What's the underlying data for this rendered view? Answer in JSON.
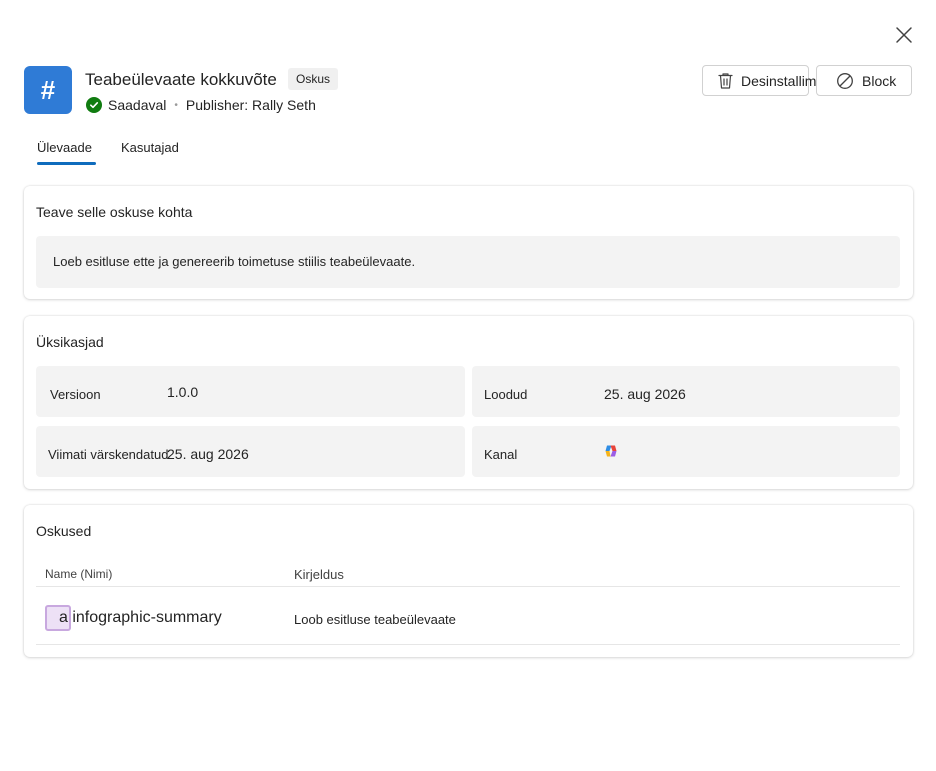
{
  "header": {
    "title": "Teabeülevaate kokkuvõte",
    "type_badge": "Oskus",
    "status": "Saadaval",
    "publisher": "Publisher: Rally Seth",
    "app_icon_glyph": "#",
    "app_icon_color": "#2f7bd6",
    "status_color": "#107c10"
  },
  "actions": {
    "uninstall_label": "Desinstallimine",
    "block_label": "Block"
  },
  "tabs": [
    {
      "label": "Ülevaade",
      "selected": true
    },
    {
      "label": "Kasutajad",
      "selected": false
    }
  ],
  "about": {
    "title": "Teave selle oskuse kohta",
    "description": "Loeb esitluse ette ja genereerib toimetuse stiilis teabeülevaate."
  },
  "details": {
    "title": "Üksikasjad",
    "version_label": "Versioon",
    "version_value": "1.0.0",
    "created_label": "Loodud",
    "created_value": "25. aug 2026",
    "updated_label": "Viimati värskendatud",
    "updated_value": "25. aug 2026",
    "channel_label": "Kanal",
    "channel_icon": "copilot-icon"
  },
  "skills": {
    "title": "Oskused",
    "columns": [
      "Name (Nimi)",
      "Kirjeldus"
    ],
    "rows": [
      {
        "name": "a infographic-summary",
        "description": "Loob esitluse teabeülevaate"
      }
    ]
  }
}
